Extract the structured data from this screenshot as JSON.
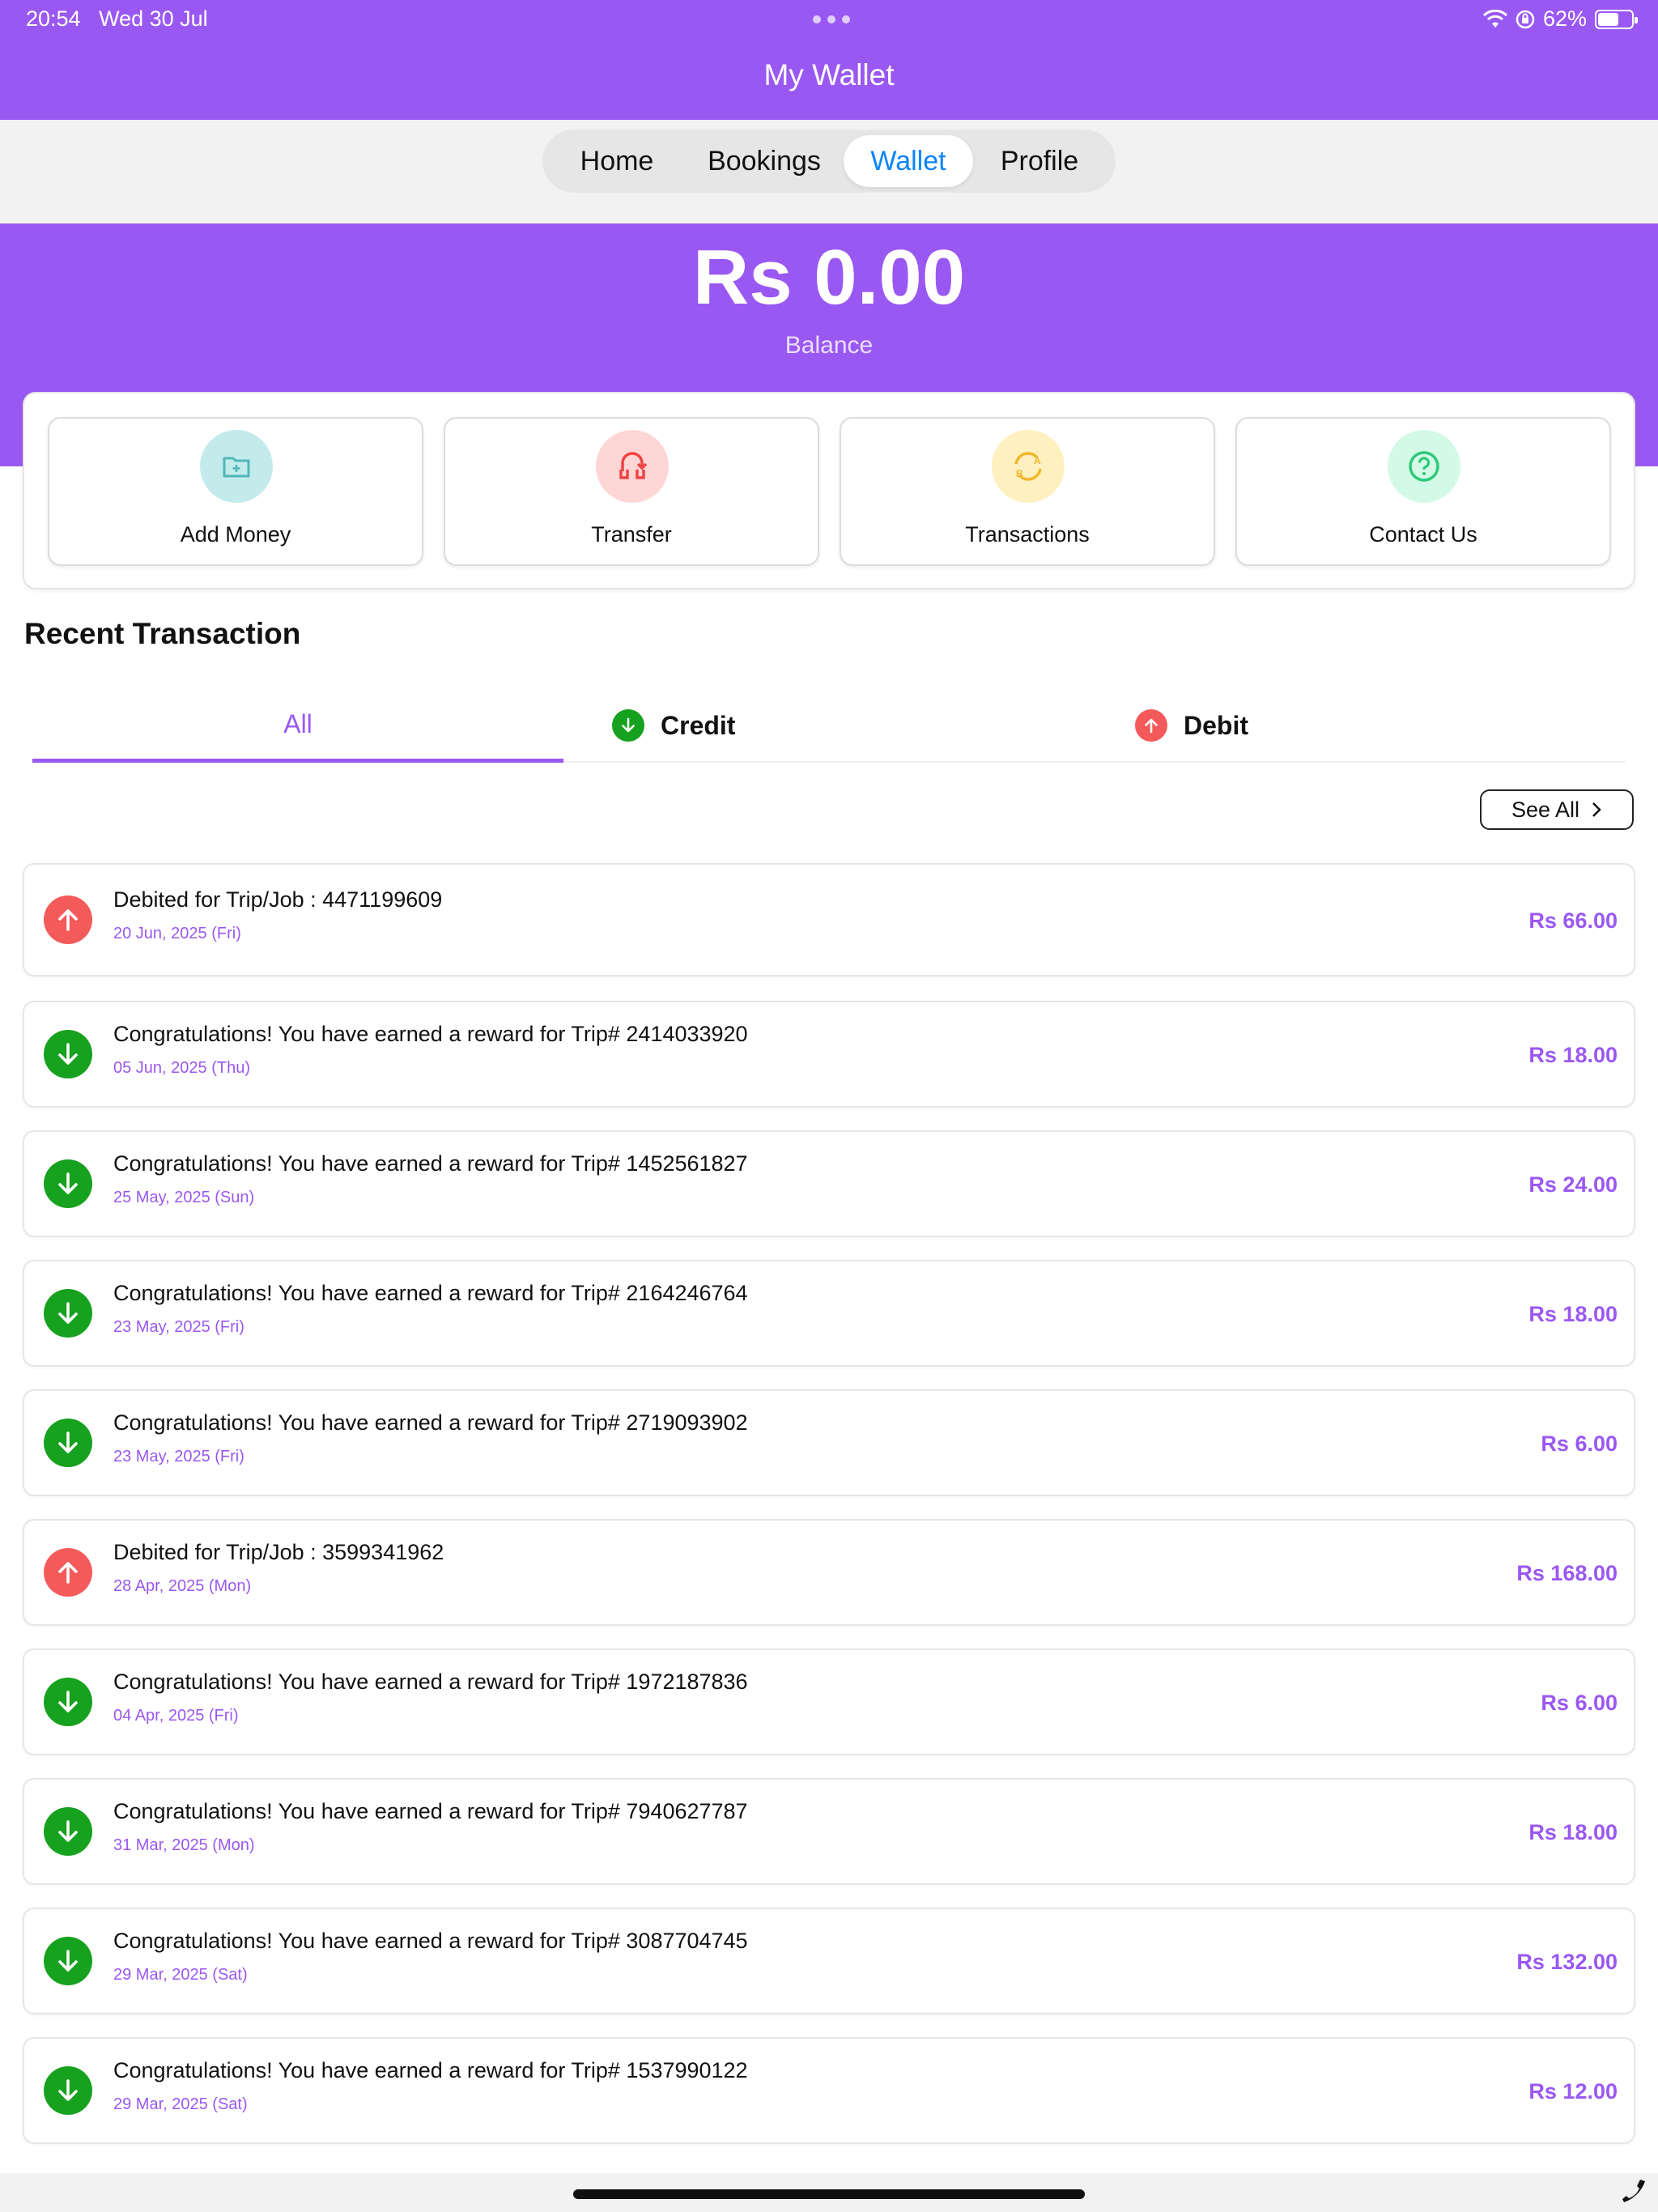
{
  "status_bar": {
    "time": "20:54",
    "date": "Wed 30 Jul",
    "battery_percent": "62%",
    "battery_level": 0.62
  },
  "header": {
    "title": "My Wallet"
  },
  "nav": {
    "tabs": [
      {
        "label": "Home"
      },
      {
        "label": "Bookings"
      },
      {
        "label": "Wallet",
        "active": true
      },
      {
        "label": "Profile"
      }
    ]
  },
  "balance": {
    "amount": "Rs 0.00",
    "label": "Balance"
  },
  "actions": [
    {
      "label": "Add Money",
      "icon": "folder-plus-icon",
      "bg": "#C4EBEB",
      "fg": "#4FB7B7"
    },
    {
      "label": "Transfer",
      "icon": "transfer-icon",
      "bg": "#FFD6D6",
      "fg": "#EE4444"
    },
    {
      "label": "Transactions",
      "icon": "exchange-icon",
      "bg": "#FFF0BF",
      "fg": "#F2B72C"
    },
    {
      "label": "Contact Us",
      "icon": "help-icon",
      "bg": "#D3FAE6",
      "fg": "#2EC97A"
    }
  ],
  "recent": {
    "title": "Recent Transaction",
    "tabs": {
      "all": "All",
      "credit": "Credit",
      "debit": "Debit"
    },
    "see_all": "See All"
  },
  "transactions": [
    {
      "type": "debit",
      "title": "Debited for Trip/Job : 4471199609",
      "date": "20 Jun, 2025 (Fri)",
      "amount": "Rs 66.00"
    },
    {
      "type": "credit",
      "title": "Congratulations! You have earned a reward for Trip# 2414033920",
      "date": "05 Jun, 2025 (Thu)",
      "amount": "Rs 18.00"
    },
    {
      "type": "credit",
      "title": "Congratulations! You have earned a reward for Trip# 1452561827",
      "date": "25 May, 2025 (Sun)",
      "amount": "Rs 24.00"
    },
    {
      "type": "credit",
      "title": "Congratulations! You have earned a reward for Trip# 2164246764",
      "date": "23 May, 2025 (Fri)",
      "amount": "Rs 18.00"
    },
    {
      "type": "credit",
      "title": "Congratulations! You have earned a reward for Trip# 2719093902",
      "date": "23 May, 2025 (Fri)",
      "amount": "Rs 6.00"
    },
    {
      "type": "debit",
      "title": "Debited for Trip/Job : 3599341962",
      "date": "28 Apr, 2025 (Mon)",
      "amount": "Rs 168.00"
    },
    {
      "type": "credit",
      "title": "Congratulations! You have earned a reward for Trip# 1972187836",
      "date": "04 Apr, 2025 (Fri)",
      "amount": "Rs 6.00"
    },
    {
      "type": "credit",
      "title": "Congratulations! You have earned a reward for Trip# 7940627787",
      "date": "31 Mar, 2025 (Mon)",
      "amount": "Rs 18.00"
    },
    {
      "type": "credit",
      "title": "Congratulations! You have earned a reward for Trip# 3087704745",
      "date": "29 Mar, 2025 (Sat)",
      "amount": "Rs 132.00"
    },
    {
      "type": "credit",
      "title": "Congratulations! You have earned a reward for Trip# 1537990122",
      "date": "29 Mar, 2025 (Sat)",
      "amount": "Rs 12.00"
    }
  ]
}
